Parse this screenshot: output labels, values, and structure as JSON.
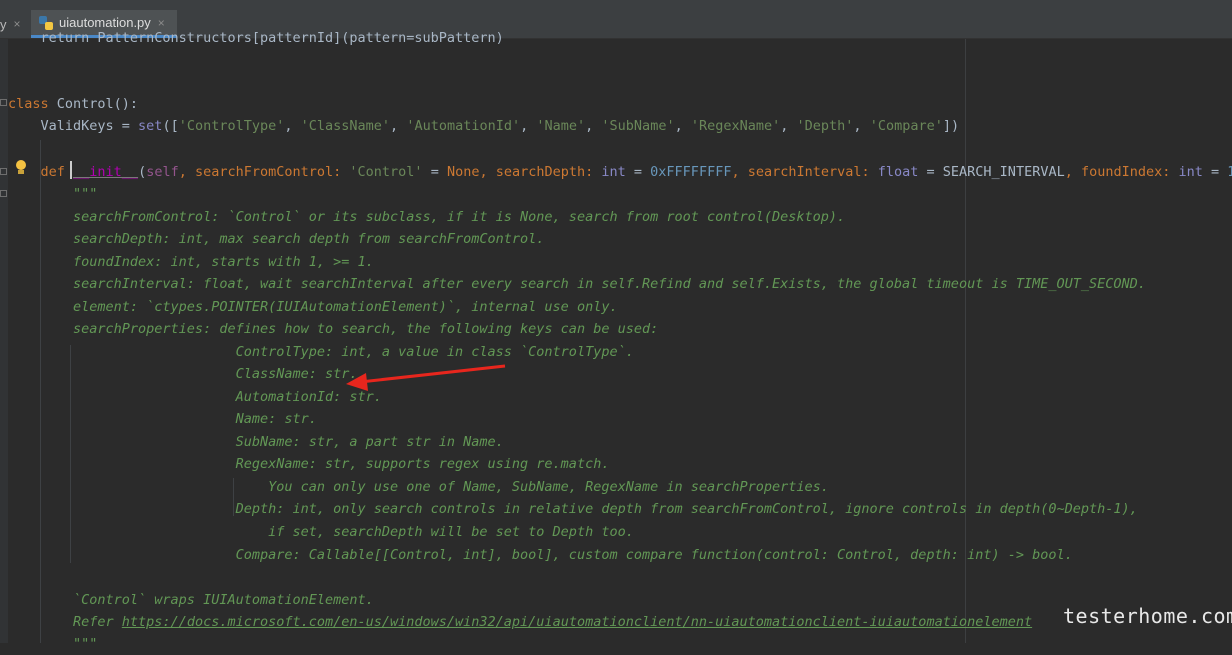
{
  "tabs": [
    {
      "label": "y",
      "close": "×"
    },
    {
      "label": "uiautomation.py",
      "close": "×",
      "active": true
    }
  ],
  "code": {
    "line_top": "    return PatternConstructors[patternId](pattern=subPattern)",
    "class_kw": "class",
    "class_rest": " Control():",
    "validkeys_pre": "    ValidKeys = ",
    "validkeys_set": "set",
    "validkeys_open": "([",
    "validkeys_items": [
      "'ControlType'",
      "'ClassName'",
      "'AutomationId'",
      "'Name'",
      "'SubName'",
      "'RegexName'",
      "'Depth'",
      "'Compare'"
    ],
    "validkeys_sep": ", ",
    "validkeys_close": "])",
    "def_kw": "    def ",
    "def_name": "__init__",
    "def_open": "(",
    "def_self": "self",
    "def_p1": ", searchFromControl: ",
    "def_p1_type": "'Control'",
    "def_p1_eq": " = ",
    "def_p1_val": "None",
    "def_p2": ", searchDepth: ",
    "def_p2_type": "int",
    "def_p2_eq": " = ",
    "def_p2_val": "0xFFFFFFFF",
    "def_p3": ", searchInterval: ",
    "def_p3_type": "float",
    "def_p3_eq": " = SEARCH_INTERVAL",
    "def_p4": ", foundIndex: ",
    "def_p4_type": "int",
    "def_p4_eq": " = ",
    "def_p4_val": "1",
    "def_tail": ",",
    "doc_lines": [
      "        \"\"\"",
      "        searchFromControl: `Control` or its subclass, if it is None, search from root control(Desktop).",
      "        searchDepth: int, max search depth from searchFromControl.",
      "        foundIndex: int, starts with 1, >= 1.",
      "        searchInterval: float, wait searchInterval after every search in self.Refind and self.Exists, the global timeout is TIME_OUT_SECOND.",
      "        element: `ctypes.POINTER(IUIAutomationElement)`, internal use only.",
      "        searchProperties: defines how to search, the following keys can be used:",
      "                            ControlType: int, a value in class `ControlType`.",
      "                            ClassName: str.",
      "                            AutomationId: str.",
      "                            Name: str.",
      "                            SubName: str, a part str in Name.",
      "                            RegexName: str, supports regex using re.match.",
      "                                You can only use one of Name, SubName, RegexName in searchProperties.",
      "                            Depth: int, only search controls in relative depth from searchFromControl, ignore controls in depth(0~Depth-1),",
      "                                if set, searchDepth will be set to Depth too.",
      "                            Compare: Callable[[Control, int], bool], custom compare function(control: Control, depth: int) -> bool.",
      "",
      "        `Control` wraps IUIAutomationElement."
    ],
    "refer_pre": "        Refer ",
    "refer_url": "https://docs.microsoft.com/en-us/windows/win32/api/uiautomationclient/nn-uiautomationclient-iuiautomationelement",
    "doc_close": "        \"\"\""
  },
  "watermark": "testerhome.com",
  "colors": {
    "background": "#2b2b2b",
    "keyword": "#cc7832",
    "string": "#6a8759",
    "docstring": "#629755",
    "number": "#6897bb",
    "annotation_arrow": "#e8261d"
  }
}
